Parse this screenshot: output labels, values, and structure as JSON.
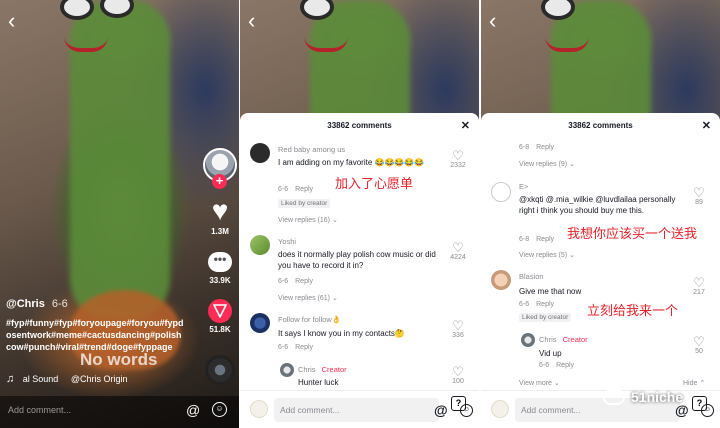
{
  "panel1": {
    "back_icon": "chevron-left-icon",
    "likes": "1.3M",
    "comments": "33.9K",
    "shares": "51.8K",
    "username": "@Chris",
    "date": "6-6",
    "caption": "#fyp#funny#fyp#foryoupage#foryou#fypdosentwork#meme#cactusdancing#polishcow#punch#viral#trend#doge#fyppage",
    "overlay_text": "No words",
    "music_name": "al Sound",
    "music_author": "@Chris Origin",
    "add_comment_placeholder": "Add comment...",
    "colors": {
      "accent": "#fe2c55"
    }
  },
  "panel2": {
    "header": "33862 comments",
    "comments": [
      {
        "user": "Red baby among us",
        "text": "I am adding on my favorite 😂😂😂😂😂",
        "date": "6-6",
        "reply": "Reply",
        "badge": "Liked by creator",
        "likes": "2332",
        "view_replies": "View replies (16)",
        "annotation": "加入了心愿单"
      },
      {
        "user": "Yoshi",
        "text": "does it normally play polish cow music or did you have to record it in?",
        "date": "6-6",
        "reply": "Reply",
        "likes": "4224",
        "view_replies": "View replies (61)"
      },
      {
        "user": "Follow for follow👌",
        "text": "It says I know you in my contacts🤔",
        "date": "6-6",
        "reply": "Reply",
        "likes": "336"
      },
      {
        "user": "Chris",
        "creator_tag": "Creator",
        "text": "Hunter luck",
        "likes": "100"
      }
    ],
    "add_comment_placeholder": "Add comment..."
  },
  "panel3": {
    "header": "33862 comments",
    "top_meta": {
      "date": "6-8",
      "reply": "Reply",
      "view_replies": "View replies (9)"
    },
    "comments": [
      {
        "user": "E>",
        "text": "@xkqti @.mia_wilkie @luvdlailaa personally right i think you should buy me this.",
        "date": "6-8",
        "reply": "Reply",
        "likes": "89",
        "view_replies": "View replies (5)",
        "annotation": "我想你应该买一个送我"
      },
      {
        "user": "Blasion",
        "text": "Give me that now",
        "date": "6-6",
        "reply": "Reply",
        "badge": "Liked by creator",
        "likes": "217",
        "annotation": "立刻给我来一个"
      },
      {
        "user": "Chris",
        "creator_tag": "Creator",
        "text": "Vid up",
        "date": "6-6",
        "reply": "Reply",
        "likes": "50"
      }
    ],
    "view_more": "View more",
    "hide": "Hide",
    "add_comment_placeholder": "Add comment...",
    "site_mark": "51niche"
  }
}
